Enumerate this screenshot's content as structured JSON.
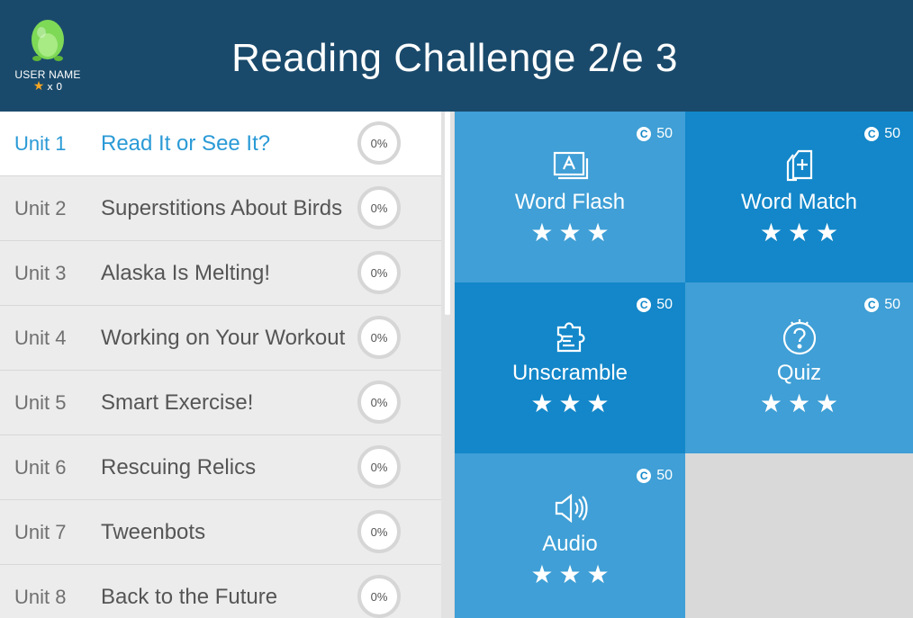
{
  "header": {
    "title": "Reading Challenge 2/e 3",
    "user": {
      "name": "USER NAME",
      "star_count": "x 0",
      "avatar_icon": "dinosaur-egg-avatar"
    }
  },
  "units": [
    {
      "number": "Unit 1",
      "title": "Read It or See It?",
      "progress": "0%",
      "active": true
    },
    {
      "number": "Unit 2",
      "title": "Superstitions About Birds",
      "progress": "0%",
      "active": false
    },
    {
      "number": "Unit 3",
      "title": "Alaska Is Melting!",
      "progress": "0%",
      "active": false
    },
    {
      "number": "Unit 4",
      "title": "Working on Your Workout",
      "progress": "0%",
      "active": false
    },
    {
      "number": "Unit 5",
      "title": "Smart Exercise!",
      "progress": "0%",
      "active": false
    },
    {
      "number": "Unit 6",
      "title": "Rescuing Relics",
      "progress": "0%",
      "active": false
    },
    {
      "number": "Unit 7",
      "title": "Tweenbots",
      "progress": "0%",
      "active": false
    },
    {
      "number": "Unit 8",
      "title": "Back to the Future",
      "progress": "0%",
      "active": false
    }
  ],
  "activities": [
    {
      "label": "Word Flash",
      "coins": "50",
      "icon": "word-flash-icon",
      "stars": 3
    },
    {
      "label": "Word Match",
      "coins": "50",
      "icon": "word-match-icon",
      "stars": 3
    },
    {
      "label": "Unscramble",
      "coins": "50",
      "icon": "puzzle-icon",
      "stars": 3
    },
    {
      "label": "Quiz",
      "coins": "50",
      "icon": "question-icon",
      "stars": 3
    },
    {
      "label": "Audio",
      "coins": "50",
      "icon": "speaker-icon",
      "stars": 3
    }
  ],
  "colors": {
    "header_bg": "#1a4a6b",
    "tile_light": "#3f9fd6",
    "tile_dark": "#1387c9",
    "active_text": "#2a9ad6",
    "star_gold": "#f5a623"
  }
}
